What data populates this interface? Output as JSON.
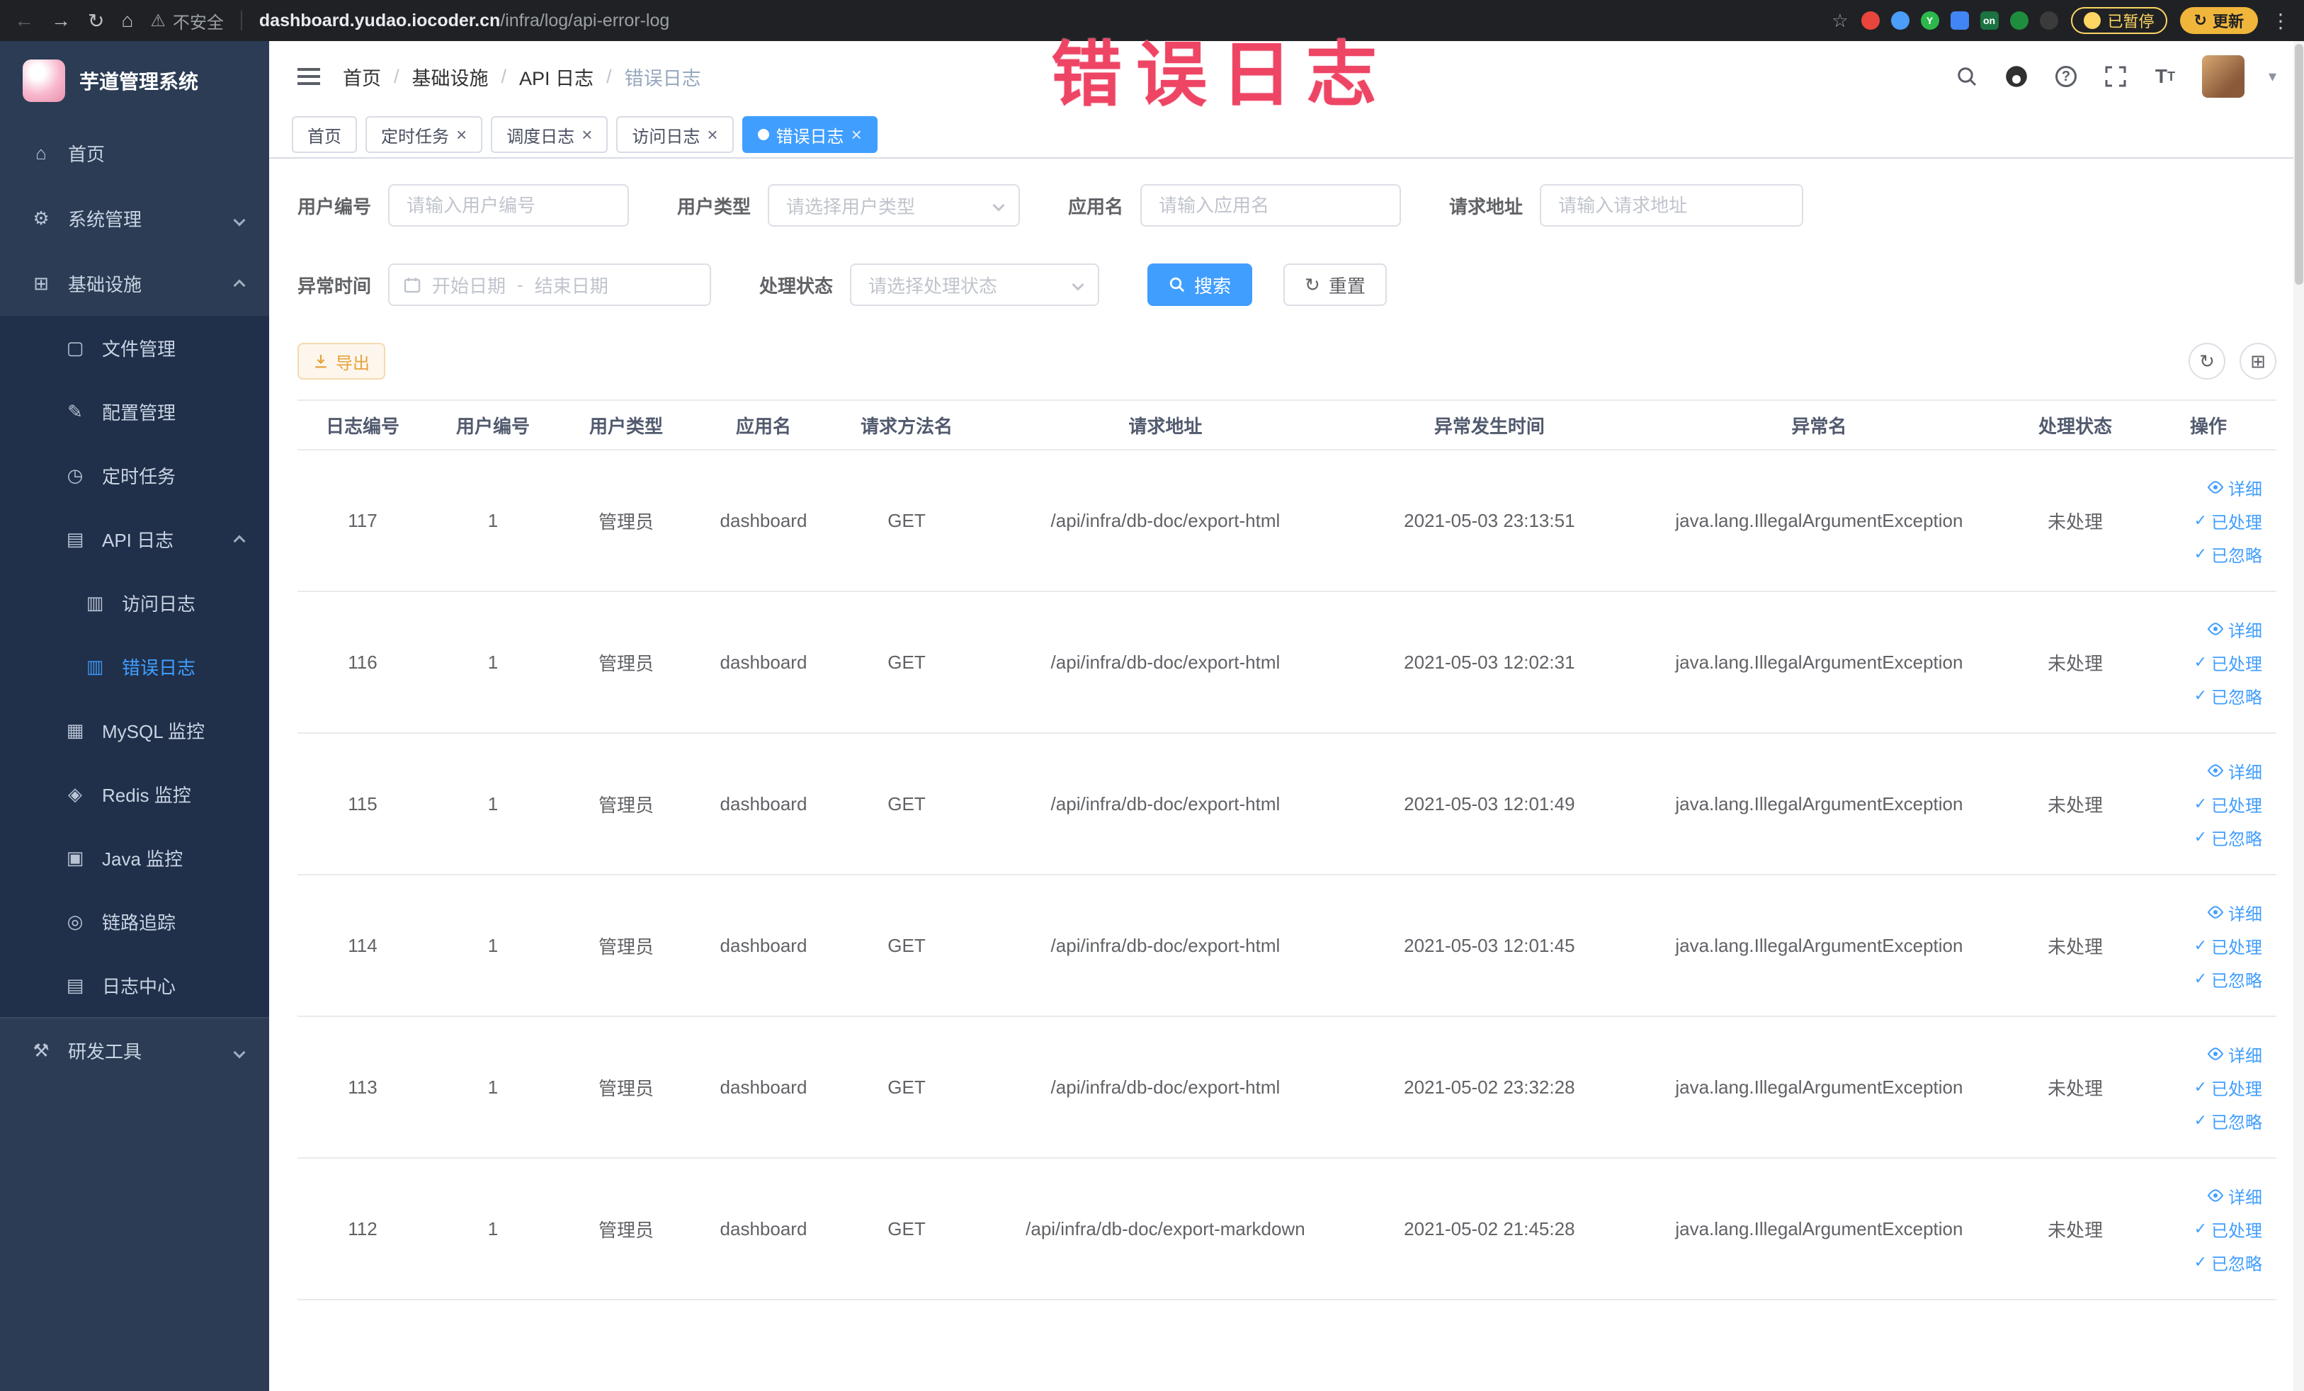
{
  "colors": {
    "accent": "#409eff",
    "warning": "#e6a23c",
    "annotation": "#ee4565"
  },
  "browser": {
    "security_label": "不安全",
    "url_host": "dashboard.yudao.iocoder.cn",
    "url_path": "/infra/log/api-error-log",
    "paused_badge": "已暂停",
    "update_button": "更新",
    "extensions": [
      {
        "name": "extension-red-icon",
        "color": "#e8453c",
        "label": ""
      },
      {
        "name": "extension-blue-drop-icon",
        "color": "#4a9df8",
        "label": ""
      },
      {
        "name": "extension-green-circle-icon",
        "color": "#2db84d",
        "label": "Y"
      },
      {
        "name": "extension-grid-icon",
        "color": "#4285f4",
        "label": "",
        "square": true
      },
      {
        "name": "extension-on-badge-icon",
        "color": "#1a7340",
        "label": "on",
        "square": true
      },
      {
        "name": "extension-sprout-icon",
        "color": "#1e8e3e",
        "label": ""
      },
      {
        "name": "extension-paw-icon",
        "color": "#3b3b3b",
        "label": ""
      }
    ]
  },
  "annotation": {
    "text": "错误日志"
  },
  "sidebar": {
    "brand": "芋道管理系统",
    "items": [
      {
        "label": "首页",
        "icon": "home-icon",
        "level": 1
      },
      {
        "label": "系统管理",
        "icon": "gear-icon",
        "level": 1,
        "arrow": "down"
      },
      {
        "label": "基础设施",
        "icon": "infra-icon",
        "level": 1,
        "arrow": "up"
      },
      {
        "label": "文件管理",
        "icon": "file-icon",
        "level": 2
      },
      {
        "label": "配置管理",
        "icon": "config-icon",
        "level": 2
      },
      {
        "label": "定时任务",
        "icon": "timer-icon",
        "level": 2
      },
      {
        "label": "API 日志",
        "icon": "api-log-icon",
        "level": 2,
        "arrow": "up"
      },
      {
        "label": "访问日志",
        "icon": "access-log-icon",
        "level": 3
      },
      {
        "label": "错误日志",
        "icon": "error-log-icon",
        "level": 3,
        "active": true
      },
      {
        "label": "MySQL 监控",
        "icon": "mysql-icon",
        "level": 2
      },
      {
        "label": "Redis 监控",
        "icon": "redis-icon",
        "level": 2
      },
      {
        "label": "Java 监控",
        "icon": "java-icon",
        "level": 2
      },
      {
        "label": "链路追踪",
        "icon": "trace-icon",
        "level": 2
      },
      {
        "label": "日志中心",
        "icon": "log-center-icon",
        "level": 2
      },
      {
        "label": "研发工具",
        "icon": "tools-icon",
        "level": 1,
        "arrow": "down",
        "sep": true
      }
    ]
  },
  "header": {
    "breadcrumbs": [
      "首页",
      "基础设施",
      "API 日志",
      "错误日志"
    ]
  },
  "tabs": [
    {
      "label": "首页",
      "closable": false,
      "active": false
    },
    {
      "label": "定时任务",
      "closable": true,
      "active": false
    },
    {
      "label": "调度日志",
      "closable": true,
      "active": false
    },
    {
      "label": "访问日志",
      "closable": true,
      "active": false
    },
    {
      "label": "错误日志",
      "closable": true,
      "active": true
    }
  ],
  "filters": {
    "user_id_label": "用户编号",
    "user_id_placeholder": "请输入用户编号",
    "user_type_label": "用户类型",
    "user_type_placeholder": "请选择用户类型",
    "app_name_label": "应用名",
    "app_name_placeholder": "请输入应用名",
    "request_url_label": "请求地址",
    "request_url_placeholder": "请输入请求地址",
    "exception_time_label": "异常时间",
    "start_date_placeholder": "开始日期",
    "date_separator": "-",
    "end_date_placeholder": "结束日期",
    "process_status_label": "处理状态",
    "process_status_placeholder": "请选择处理状态",
    "search_button": "搜索",
    "reset_button": "重置"
  },
  "toolbar": {
    "export_button": "导出"
  },
  "table": {
    "headers": [
      "日志编号",
      "用户编号",
      "用户类型",
      "应用名",
      "请求方法名",
      "请求地址",
      "异常发生时间",
      "异常名",
      "处理状态",
      "操作"
    ],
    "action_labels": [
      "详细",
      "已处理",
      "已忽略"
    ],
    "rows": [
      {
        "id": "117",
        "user_id": "1",
        "user_type": "管理员",
        "app": "dashboard",
        "method": "GET",
        "url": "/api/infra/db-doc/export-html",
        "time": "2021-05-03 23:13:51",
        "exception": "java.lang.IllegalArgumentException",
        "status": "未处理"
      },
      {
        "id": "116",
        "user_id": "1",
        "user_type": "管理员",
        "app": "dashboard",
        "method": "GET",
        "url": "/api/infra/db-doc/export-html",
        "time": "2021-05-03 12:02:31",
        "exception": "java.lang.IllegalArgumentException",
        "status": "未处理"
      },
      {
        "id": "115",
        "user_id": "1",
        "user_type": "管理员",
        "app": "dashboard",
        "method": "GET",
        "url": "/api/infra/db-doc/export-html",
        "time": "2021-05-03 12:01:49",
        "exception": "java.lang.IllegalArgumentException",
        "status": "未处理"
      },
      {
        "id": "114",
        "user_id": "1",
        "user_type": "管理员",
        "app": "dashboard",
        "method": "GET",
        "url": "/api/infra/db-doc/export-html",
        "time": "2021-05-03 12:01:45",
        "exception": "java.lang.IllegalArgumentException",
        "status": "未处理"
      },
      {
        "id": "113",
        "user_id": "1",
        "user_type": "管理员",
        "app": "dashboard",
        "method": "GET",
        "url": "/api/infra/db-doc/export-html",
        "time": "2021-05-02 23:32:28",
        "exception": "java.lang.IllegalArgumentException",
        "status": "未处理"
      },
      {
        "id": "112",
        "user_id": "1",
        "user_type": "管理员",
        "app": "dashboard",
        "method": "GET",
        "url": "/api/infra/db-doc/export-markdown",
        "time": "2021-05-02 21:45:28",
        "exception": "java.lang.IllegalArgumentException",
        "status": "未处理"
      }
    ]
  }
}
